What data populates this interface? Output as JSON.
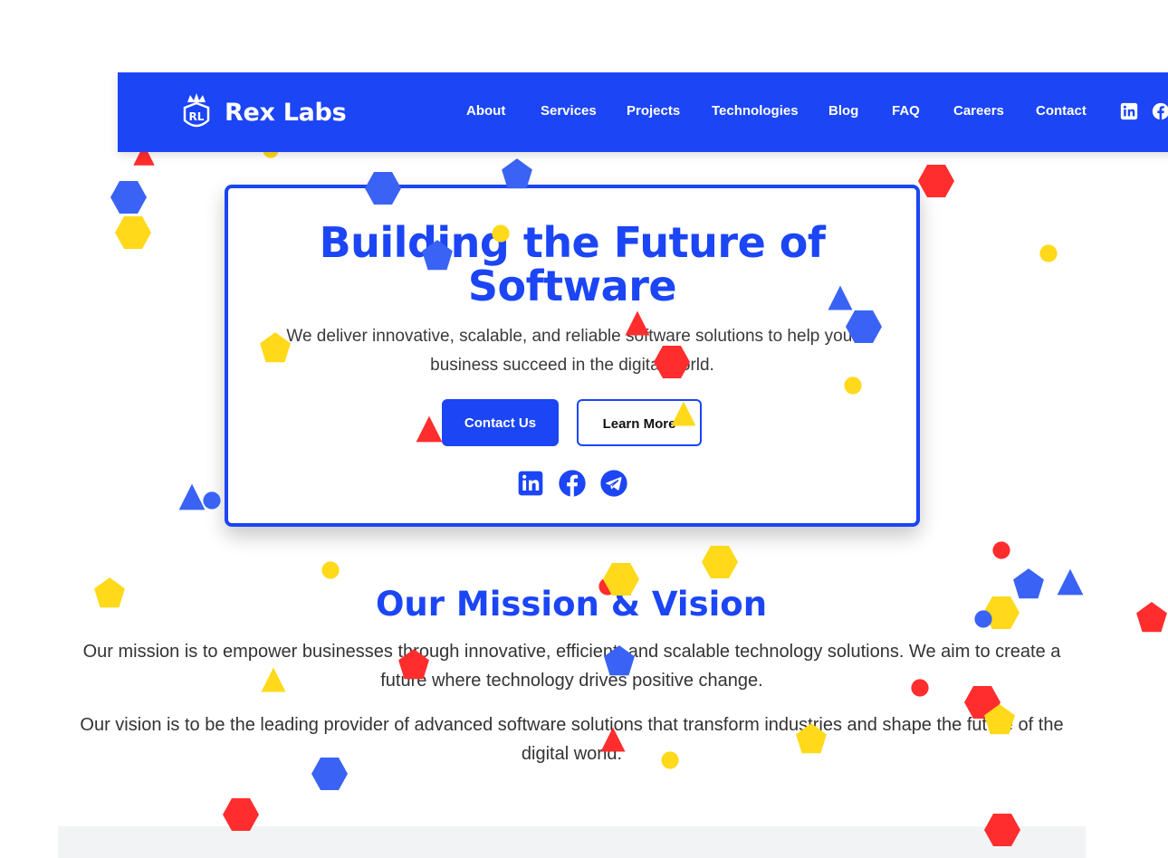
{
  "colors": {
    "brand_blue": "#1b45f5",
    "shape_red": "#ff2d2d",
    "shape_yellow": "#ffd91a",
    "shape_blue": "#3a63f5",
    "text_dark": "#333333",
    "band_grey": "#f2f3f5"
  },
  "navbar": {
    "brand_name": "Rex Labs",
    "brand_logo_text": "RL",
    "links": [
      {
        "label": "About"
      },
      {
        "label": "Services"
      },
      {
        "label": "Projects"
      },
      {
        "label": "Technologies"
      },
      {
        "label": "Blog"
      },
      {
        "label": "FAQ"
      },
      {
        "label": "Careers"
      },
      {
        "label": "Contact"
      }
    ],
    "social_icons": [
      "linkedin-icon",
      "facebook-icon"
    ]
  },
  "hero": {
    "title": "Building the Future of Software",
    "subtitle": "We deliver innovative, scalable, and reliable software solutions to help your business succeed in the digital world.",
    "primary_button": "Contact Us",
    "secondary_button": "Learn More",
    "social_icons": [
      "linkedin-icon",
      "facebook-icon",
      "telegram-icon"
    ]
  },
  "mission": {
    "title": "Our Mission & Vision",
    "mission_text": "Our mission is to empower businesses through innovative, efficient, and scalable technology solutions. We aim to create a future where technology drives positive change.",
    "vision_text": "Our vision is to be the leading provider of advanced software solutions that transform industries and shape the future of the digital world."
  }
}
